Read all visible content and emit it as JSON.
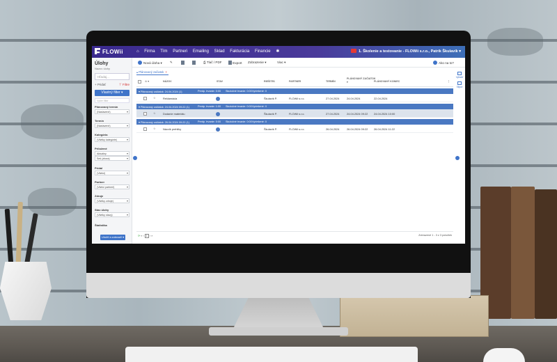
{
  "app": {
    "brand": "FLOWii",
    "nav": [
      "Firma",
      "Tím",
      "Partneri",
      "Emailing",
      "Sklad",
      "Fakturácia",
      "Financie"
    ],
    "company": "1. Školenie a testovanie - FLOWii s.r.o., Patrik Škulavík"
  },
  "sidebar": {
    "title": "Úlohy",
    "subtitle": "Nazov úlohy",
    "search_placeholder": "Hľadaj...",
    "links": {
      "left": "Pridať",
      "right": "Filtre"
    },
    "primary_button": "Vlastný filter",
    "filter_input_placeholder": "Vyber filter",
    "fields": [
      {
        "label": "Plánovaný termín",
        "value": "(Nastavené)"
      },
      {
        "label": "Termín",
        "value": "(Nastavené)"
      },
      {
        "label": "Kategória",
        "value": "(Všetky kategórie)"
      },
      {
        "label": "Priložené",
        "value": "Aktuálny"
      },
      {
        "label": "",
        "value": "Seš (zhora)"
      },
      {
        "label": "Pridal",
        "value": "(Všetci)"
      },
      {
        "label": "Partner",
        "value": "(Všetci partneri)"
      },
      {
        "label": "Zdroje",
        "value": "(Všetky zdroje)"
      },
      {
        "label": "Stav úlohy",
        "value": "(Všetky stavy)"
      },
      {
        "label": "Štatistika",
        "value": ""
      }
    ],
    "save_button": "Uložiť a zobraziť"
  },
  "toolbar": {
    "new_task": "Nová úloha",
    "print": "Tlač / PDF",
    "export": "Export",
    "view": "Zobrazenie",
    "more": "Viac",
    "help": "Ako na to?"
  },
  "tab": {
    "label": "Plánovaný začiatok"
  },
  "grid": {
    "headers": {
      "name": "NÁZOV",
      "state": "STAV",
      "solver": "RIEŠITEĽ",
      "partner": "PARTNER",
      "deadline": "TERMÍN",
      "planned_start": "PLÁNOVANÝ ZAČIATOK",
      "planned_end": "PLÁNOVANÝ KONIEC"
    },
    "groups": [
      {
        "header": "Plánovaný začiatok: 24.04.2024 (1)",
        "effort": "Predp. trvanie: 0:00",
        "actual": "Skutočné trvanie: 0:00",
        "done": "Vyriešené: 0",
        "rows": [
          {
            "name": "Reklamácia",
            "solver": "Škulavík P.",
            "partner": "FLOWii s.r.o.",
            "deadline": "27.04.2024",
            "start": "24.04.2024",
            "end": "22.04.2024"
          }
        ]
      },
      {
        "header": "Plánovaný začiatok: 24.04.2024 09:22 (1)",
        "effort": "Predp. trvanie: 1:00",
        "actual": "Skutočné trvanie: 0:00",
        "done": "Vyriešené: 0",
        "rows": [
          {
            "name": "Dodanie materiálu",
            "solver": "Škulavík P.",
            "partner": "FLOWii s.r.o.",
            "deadline": "27.04.2024",
            "start": "24.04.2024 09:22",
            "end": "24.04.2024 10:00"
          }
        ]
      },
      {
        "header": "Plánovaný začiatok: 26.04.2024 09:22 (1)",
        "effort": "Predp. trvanie: 0:00",
        "actual": "Skutočné trvanie: 0:00",
        "done": "Vyriešené: 0",
        "rows": [
          {
            "name": "Nácvik prehliky",
            "solver": "Škulavík P.",
            "partner": "FLOWii s.r.o.",
            "deadline": "26.04.2024",
            "start": "26.04.2024 09:22",
            "end": "26.04.2024 11:22"
          }
        ]
      }
    ]
  },
  "footer": {
    "page": "1",
    "summary": "Zobrazené 1 - 3 z 3 položiek"
  },
  "rightbar": {
    "top": "Vytlačiť",
    "bottom": "Stĺpce"
  }
}
